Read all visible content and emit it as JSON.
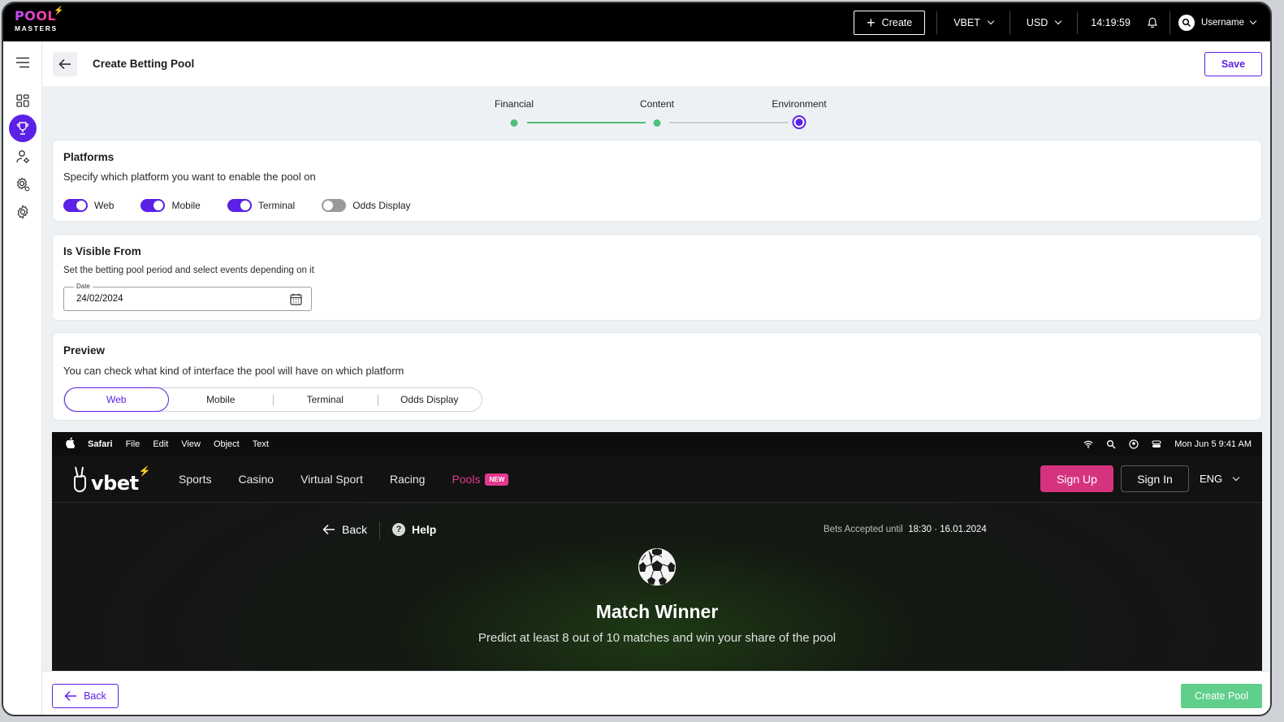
{
  "app": {
    "logo_top": "POOL",
    "logo_bottom": "MASTERS"
  },
  "topbar": {
    "create_label": "Create",
    "brand": "VBET",
    "currency": "USD",
    "time": "14:19:59",
    "username": "Username"
  },
  "header": {
    "title": "Create Betting Pool",
    "save_label": "Save"
  },
  "stepper": {
    "steps": [
      {
        "label": "Financial",
        "state": "done"
      },
      {
        "label": "Content",
        "state": "done"
      },
      {
        "label": "Environment",
        "state": "current"
      }
    ]
  },
  "platforms": {
    "title": "Platforms",
    "subtitle": "Specify which platform you want to enable the pool on",
    "toggles": [
      {
        "label": "Web",
        "on": true
      },
      {
        "label": "Mobile",
        "on": true
      },
      {
        "label": "Terminal",
        "on": true
      },
      {
        "label": "Odds Display",
        "on": false
      }
    ]
  },
  "visible_from": {
    "title": "Is Visible From",
    "subtitle": "Set the betting pool period and select events depending on it",
    "date_label": "Date",
    "date_value": "24/02/2024"
  },
  "preview": {
    "title": "Preview",
    "subtitle": "You can check what kind of interface the pool will have on which platform",
    "tabs": [
      "Web",
      "Mobile",
      "Terminal",
      "Odds Display"
    ],
    "active_tab": "Web",
    "mac_menu": [
      "Safari",
      "File",
      "Edit",
      "View",
      "Object",
      "Text"
    ],
    "mac_datetime": "Mon Jun 5  9:41 AM",
    "site": {
      "brand": "vbet",
      "nav": [
        "Sports",
        "Casino",
        "Virtual Sport",
        "Racing",
        "Pools"
      ],
      "new_badge": "NEW",
      "signup": "Sign Up",
      "signin": "Sign In",
      "lang": "ENG",
      "back": "Back",
      "help": "Help",
      "bets_prefix": "Bets Accepted until",
      "bets_time": "18:30",
      "bets_date": "16.01.2024",
      "pool_title": "Match Winner",
      "pool_subtitle": "Predict at least 8 out of 10 matches and win your share of the pool"
    }
  },
  "footer": {
    "back_label": "Back",
    "create_pool_label": "Create Pool"
  },
  "colors": {
    "accent": "#5b21e6",
    "success": "#5fcf8b",
    "pink": "#d6337f"
  }
}
